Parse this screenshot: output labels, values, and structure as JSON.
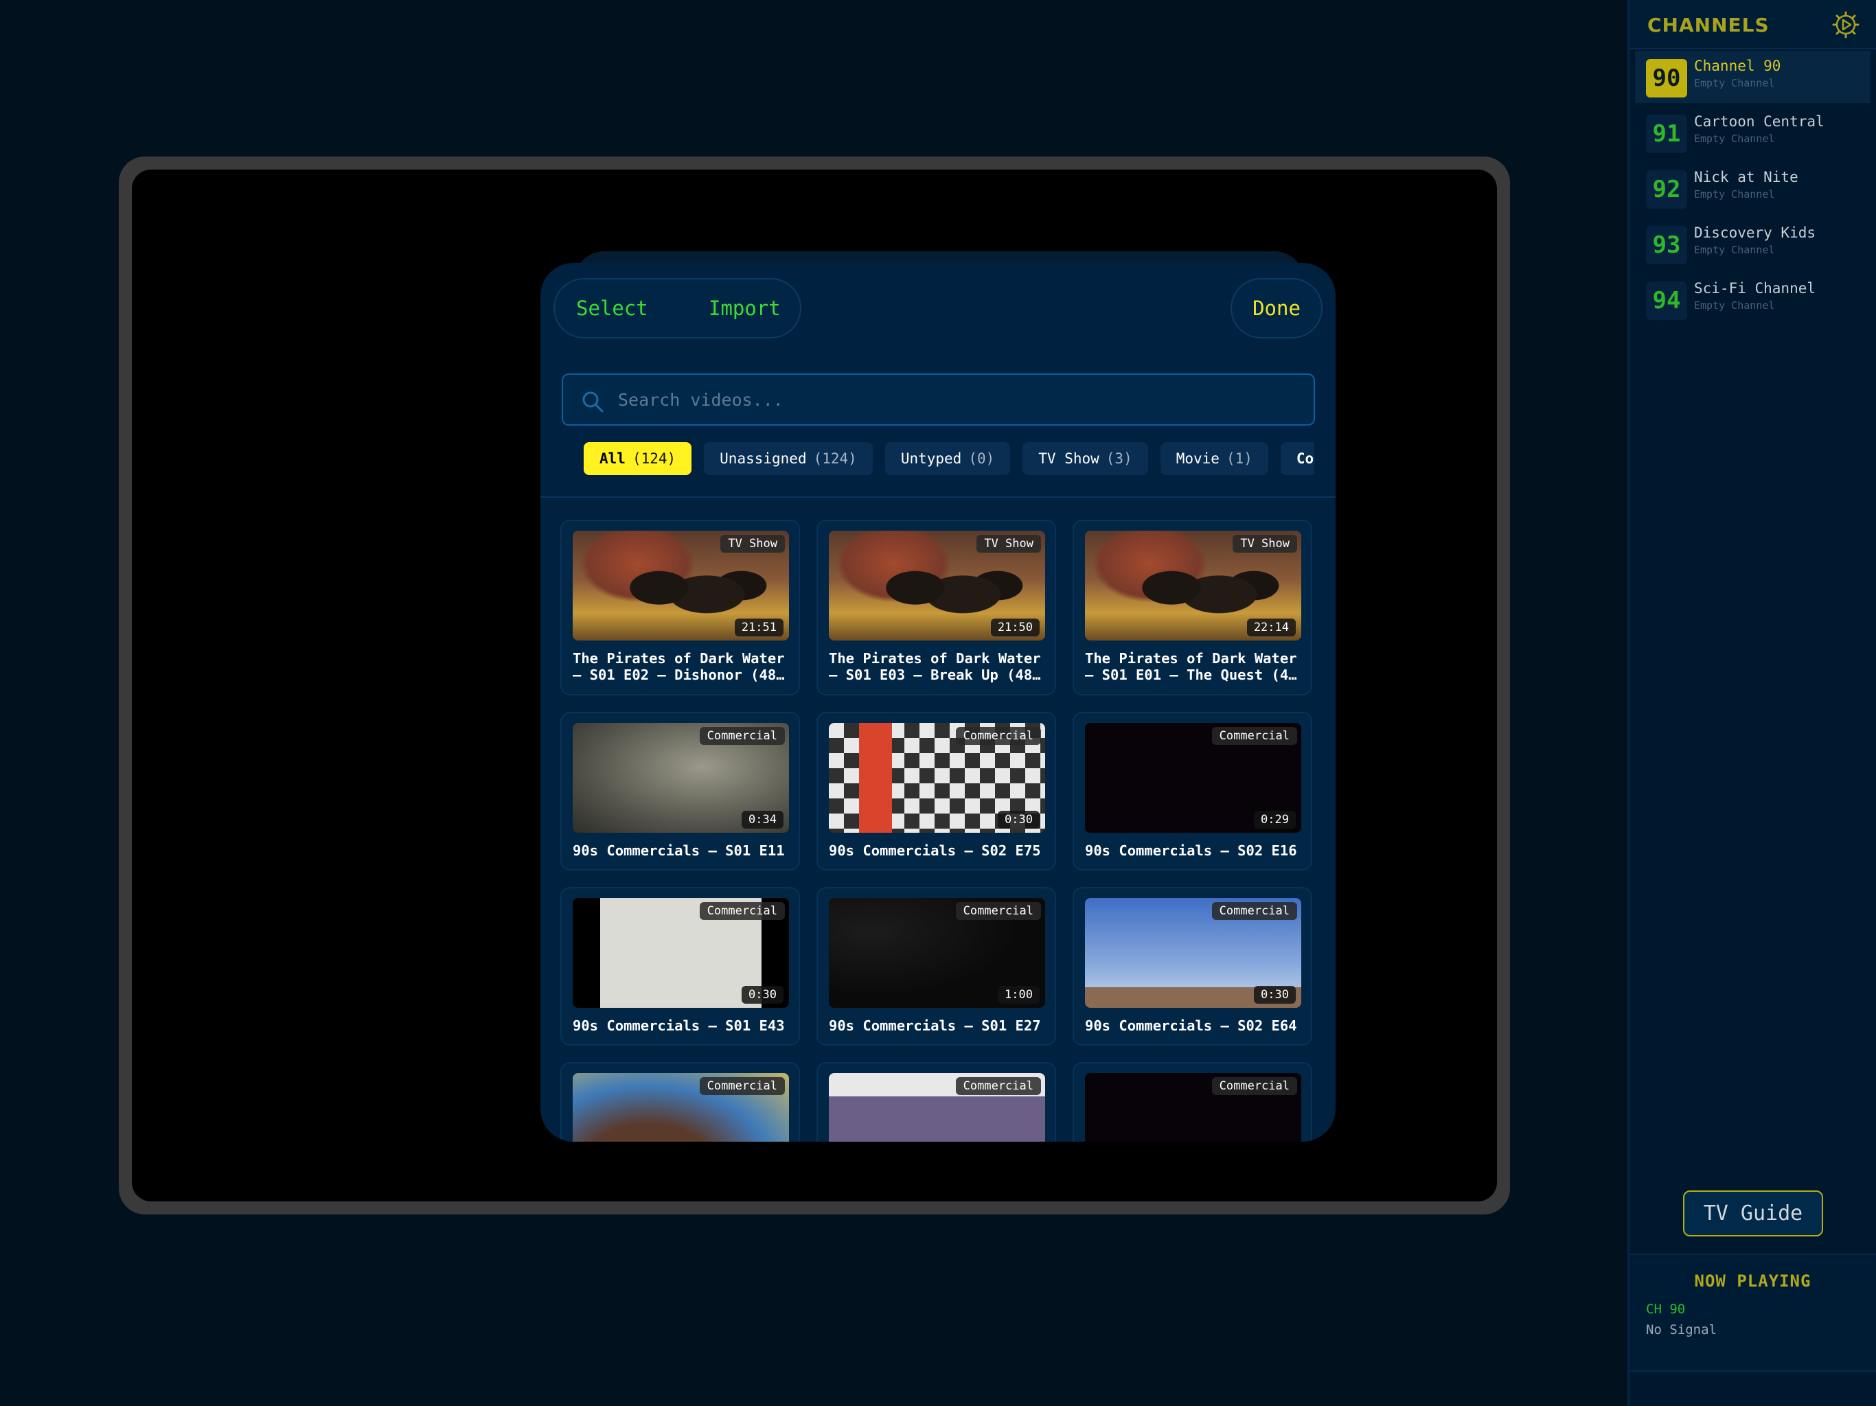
{
  "library": {
    "select_label": "Select",
    "import_label": "Import",
    "done_label": "Done",
    "search_placeholder": "Search videos...",
    "filters": [
      {
        "label": "All",
        "count": "(124)"
      },
      {
        "label": "Unassigned",
        "count": "(124)"
      },
      {
        "label": "Untyped",
        "count": "(0)"
      },
      {
        "label": "TV Show",
        "count": "(3)"
      },
      {
        "label": "Movie",
        "count": "(1)"
      },
      {
        "label": "Comm",
        "count": ""
      }
    ],
    "videos": [
      {
        "badge": "TV Show",
        "duration": "21:51",
        "title": "The Pirates of Dark Water – S01 E02 – Dishonor (48…"
      },
      {
        "badge": "TV Show",
        "duration": "21:50",
        "title": "The Pirates of Dark Water – S01 E03 – Break Up (48…"
      },
      {
        "badge": "TV Show",
        "duration": "22:14",
        "title": "The Pirates of Dark Water – S01 E01 – The Quest (4…"
      },
      {
        "badge": "Commercial",
        "duration": "0:34",
        "title": "90s Commercials – S01 E11"
      },
      {
        "badge": "Commercial",
        "duration": "0:30",
        "title": "90s Commercials – S02 E75"
      },
      {
        "badge": "Commercial",
        "duration": "0:29",
        "title": "90s Commercials – S02 E16"
      },
      {
        "badge": "Commercial",
        "duration": "0:30",
        "title": "90s Commercials – S01 E43"
      },
      {
        "badge": "Commercial",
        "duration": "1:00",
        "title": "90s Commercials – S01 E27"
      },
      {
        "badge": "Commercial",
        "duration": "0:30",
        "title": "90s Commercials – S02 E64"
      },
      {
        "badge": "Commercial"
      },
      {
        "badge": "Commercial"
      },
      {
        "badge": "Commercial"
      }
    ]
  },
  "sidebar": {
    "title": "CHANNELS",
    "channels": [
      {
        "number": "90",
        "name": "Channel 90",
        "subtitle": "Empty Channel"
      },
      {
        "number": "91",
        "name": "Cartoon Central",
        "subtitle": "Empty Channel"
      },
      {
        "number": "92",
        "name": "Nick at Nite",
        "subtitle": "Empty Channel"
      },
      {
        "number": "93",
        "name": "Discovery Kids",
        "subtitle": "Empty Channel"
      },
      {
        "number": "94",
        "name": "Sci-Fi Channel",
        "subtitle": "Empty Channel"
      }
    ],
    "tv_guide_label": "TV Guide",
    "now_playing": {
      "title": "NOW PLAYING",
      "channel": "CH 90",
      "status": "No Signal"
    }
  },
  "colors": {
    "accent_yellow": "#fff21f",
    "accent_green": "#3ddc34",
    "background": "#01111d"
  }
}
